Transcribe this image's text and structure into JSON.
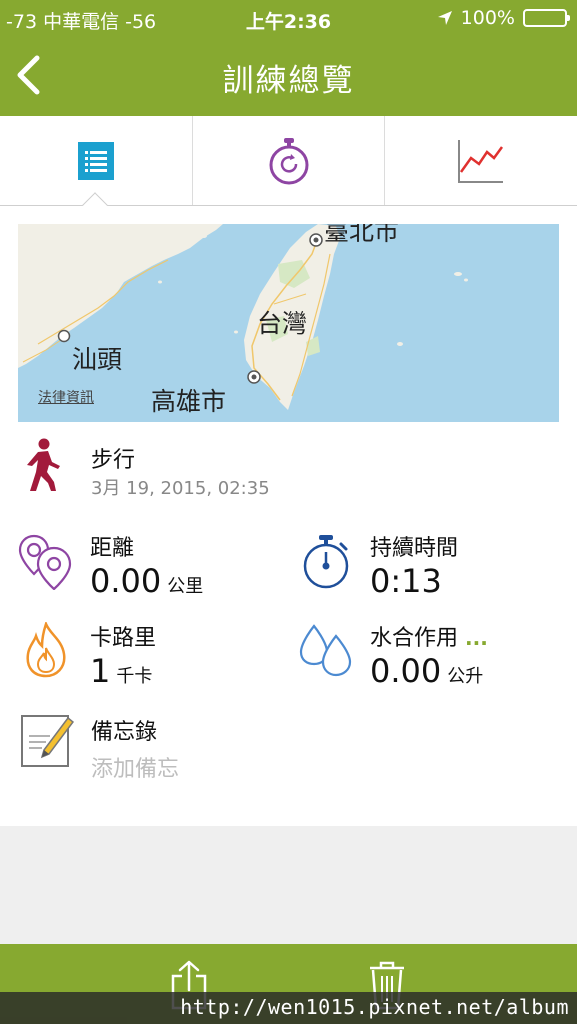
{
  "status_bar": {
    "signal": "-73 中華電信 -56",
    "time": "上午2:36",
    "battery": "100%"
  },
  "nav": {
    "title": "訓練總覽"
  },
  "map": {
    "labels": {
      "taipei": "臺北市",
      "taiwan": "台灣",
      "shantou": "汕頭",
      "kaohsiung": "高雄市"
    },
    "legal": "法律資訊"
  },
  "activity": {
    "name": "步行",
    "date": "3月 19, 2015, 02:35"
  },
  "stats": {
    "distance": {
      "label": "距離",
      "value": "0.00",
      "unit": "公里"
    },
    "duration": {
      "label": "持續時間",
      "value": "0:13"
    },
    "calories": {
      "label": "卡路里",
      "value": "1",
      "unit": "千卡"
    },
    "hydration": {
      "label": "水合作用",
      "more": "...",
      "value": "0.00",
      "unit": "公升"
    }
  },
  "memo": {
    "label": "備忘錄",
    "placeholder": "添加備忘"
  },
  "watermark": "http://wen1015.pixnet.net/album",
  "icons": {
    "back": "chevron-left-icon",
    "tab_list": "list-icon",
    "tab_lap": "stopwatch-refresh-icon",
    "tab_chart": "line-chart-icon",
    "map_search": "magnifier-icon",
    "walk": "walking-person-icon",
    "distance": "location-pins-icon",
    "duration": "stopwatch-icon",
    "calories": "flame-icon",
    "hydration": "water-drops-icon",
    "memo": "notepad-pencil-icon",
    "share": "share-icon",
    "trash": "trash-icon"
  },
  "colors": {
    "brand_green": "#87a930",
    "tab_active": "#1ba0cf",
    "accent_purple": "#8e45a3",
    "walk_red": "#a21a3b",
    "duration_blue": "#1f4f9a",
    "calories_orange": "#f0932a",
    "hydration_blue": "#4c8ad1"
  }
}
